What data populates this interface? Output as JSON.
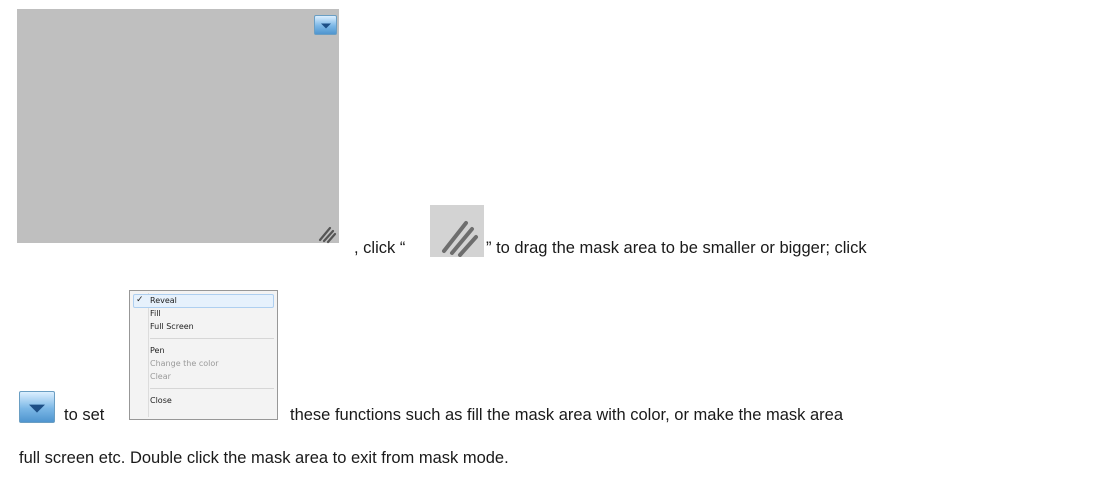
{
  "mask": {
    "dropdown_icon": "dropdown-arrow-icon",
    "resize_icon": "resize-grip-icon",
    "color": "#bfbfbf"
  },
  "paragraph": {
    "line1_a": ", click “",
    "line1_b": "” to drag the mask area to be smaller or bigger; click",
    "line2_a": "to set",
    "line2_b": "these functions such as fill the mask area with color, or make the mask area",
    "line3": "full screen etc. Double click the mask area to exit from mask mode."
  },
  "menu": {
    "check_mark": "✓",
    "items": [
      {
        "label": "Reveal",
        "checked": true,
        "enabled": true
      },
      {
        "label": "Fill",
        "enabled": true
      },
      {
        "label": "Full Screen",
        "enabled": true
      },
      {
        "label": "Pen",
        "enabled": true
      },
      {
        "label": "Change the color",
        "enabled": false
      },
      {
        "label": "Clear",
        "enabled": false
      },
      {
        "label": "Close",
        "enabled": true
      }
    ]
  }
}
